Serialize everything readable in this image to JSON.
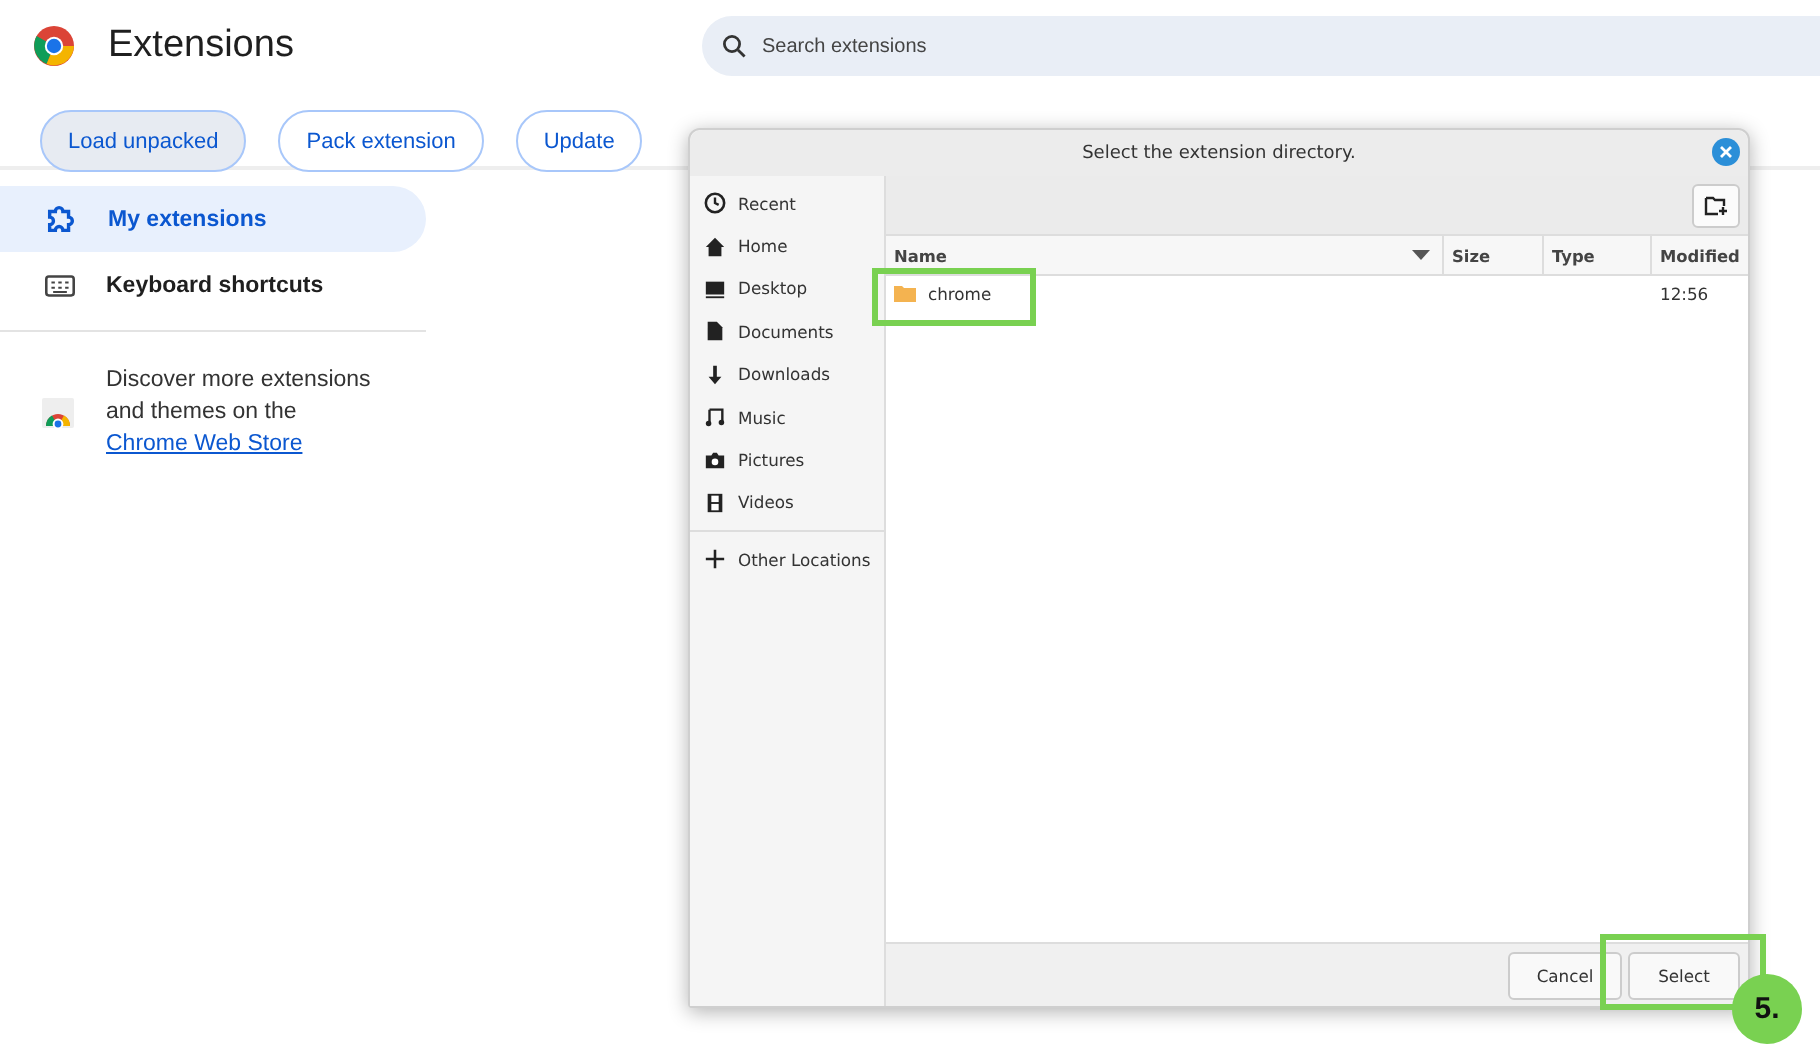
{
  "header": {
    "title": "Extensions",
    "search": {
      "placeholder": "Search extensions"
    }
  },
  "toolbar": [
    "Load unpacked",
    "Pack extension",
    "Update"
  ],
  "sidebar": {
    "items": [
      {
        "label": "My extensions",
        "kind": "puzzle",
        "selected": true
      },
      {
        "label": "Keyboard shortcuts",
        "kind": "keyboard",
        "selected": false
      }
    ],
    "promo": {
      "text": "Discover more extensions and themes on the",
      "link": "Chrome Web Store"
    }
  },
  "dialog": {
    "title": "Select the extension directory.",
    "places": [
      {
        "label": "Recent",
        "kind": "recent"
      },
      {
        "label": "Home",
        "kind": "home"
      },
      {
        "label": "Desktop",
        "kind": "desktop"
      },
      {
        "label": "Documents",
        "kind": "documents"
      },
      {
        "label": "Downloads",
        "kind": "downloads"
      },
      {
        "label": "Music",
        "kind": "music"
      },
      {
        "label": "Pictures",
        "kind": "pictures"
      },
      {
        "label": "Videos",
        "kind": "videos"
      },
      {
        "label": "Other Locations",
        "kind": "other"
      }
    ],
    "columns": [
      "Name",
      "Size",
      "Type",
      "Modified"
    ],
    "files": [
      {
        "name": "chrome",
        "kind": "folder",
        "modified": "12:56"
      }
    ],
    "buttons": [
      {
        "label": "Cancel",
        "kind": "cancel"
      },
      {
        "label": "Select",
        "kind": "confirm"
      }
    ]
  },
  "annotation": {
    "step": "5."
  }
}
